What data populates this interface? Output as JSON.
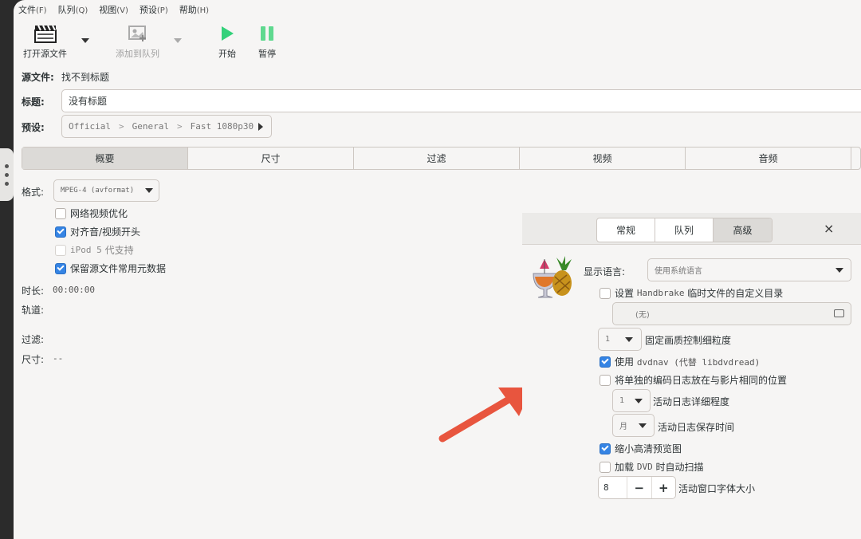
{
  "menu": [
    {
      "label": "文件",
      "accel": "(F)"
    },
    {
      "label": "队列",
      "accel": "(Q)"
    },
    {
      "label": "视图",
      "accel": "(V)"
    },
    {
      "label": "预设",
      "accel": "(P)"
    },
    {
      "label": "帮助",
      "accel": "(H)"
    }
  ],
  "toolbar": {
    "open_source": "打开源文件",
    "add_to_queue": "添加到队列",
    "start": "开始",
    "pause": "暂停"
  },
  "source": {
    "label": "源文件:",
    "value": "找不到标题"
  },
  "title": {
    "label": "标题:",
    "value": "没有标题"
  },
  "preset": {
    "label": "预设:",
    "parts": [
      "Official",
      "General",
      "Fast 1080p30"
    ]
  },
  "tabs": [
    "概要",
    "尺寸",
    "过滤",
    "视频",
    "音频"
  ],
  "summary": {
    "format_label": "格式:",
    "format_value": "MPEG-4 (avformat)",
    "checks": [
      {
        "label": "网络视频优化",
        "checked": false
      },
      {
        "label": "对齐音/视频开头",
        "checked": true
      },
      {
        "label_mono": "iPod 5",
        "label": "代支持",
        "checked": false
      },
      {
        "label": "保留源文件常用元数据",
        "checked": true
      }
    ],
    "duration_label": "时长:",
    "duration_value": "00:00:00",
    "tracks_label": "轨道:",
    "filters_label": "过滤:",
    "size_label": "尺寸:",
    "size_value": "--"
  },
  "prefs": {
    "tabs": [
      "常规",
      "队列",
      "高级"
    ],
    "close": "×",
    "lang_label": "显示语言:",
    "lang_value": "使用系统语言",
    "custom_dir_check": {
      "pre": "设置",
      "mono": "Handbrake",
      "post": "临时文件的自定义目录",
      "checked": false
    },
    "dir_value": "(无)",
    "quality_value": "1",
    "quality_label": "固定画质控制细粒度",
    "dvdnav_check": {
      "pre": "使用",
      "mono": "dvdnav (代替 libdvdread)",
      "checked": true
    },
    "separate_log_check": {
      "label": "将单独的编码日志放在与影片相同的位置",
      "checked": false
    },
    "log_level_value": "1",
    "log_level_label": "活动日志详细程度",
    "log_keep_value": "月",
    "log_keep_label": "活动日志保存时间",
    "scale_preview_check": {
      "label": "缩小高清预览图",
      "checked": true
    },
    "dvd_scan_check": {
      "pre": "加载",
      "mono": "DVD",
      "post": "时自动扫描",
      "checked": false
    },
    "font_size_value": "8",
    "font_size_minus": "−",
    "font_size_plus": "+",
    "font_size_label": "活动窗口字体大小"
  },
  "colors": {
    "accent": "#3584e4",
    "play": "#33d17a",
    "arrow": "#e8553e"
  }
}
